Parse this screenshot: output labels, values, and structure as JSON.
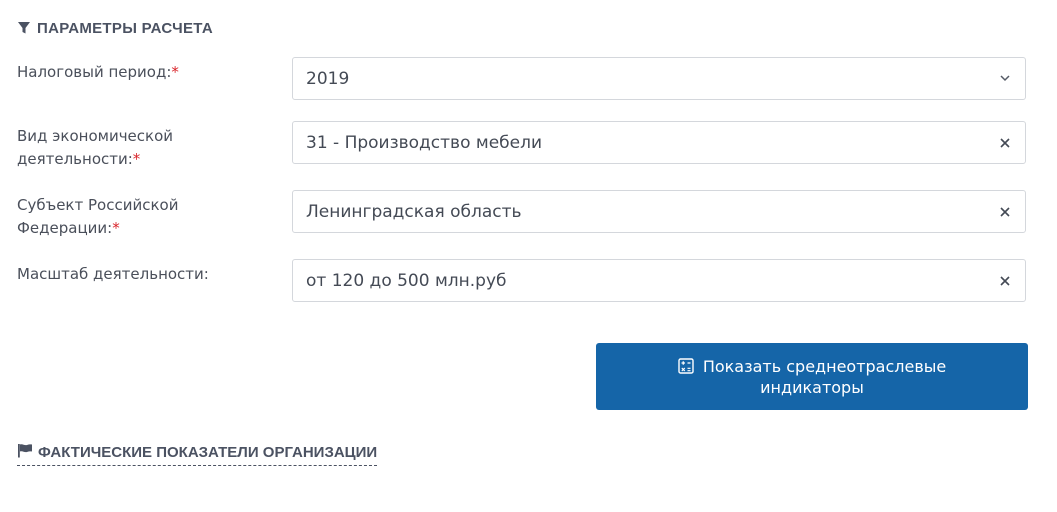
{
  "section": {
    "title": "ПАРАМЕТРЫ РАСЧЕТА",
    "icon": "filter-icon"
  },
  "form": {
    "required_mark": "*",
    "fields": [
      {
        "label": "Налоговый период:",
        "value": "2019",
        "control": "select",
        "icon": "chevron-down-icon"
      },
      {
        "label_line1": "Вид экономической",
        "label_line2": "деятельности:",
        "value": "31 - Производство мебели",
        "control": "clearable-select",
        "icon": "clear-icon"
      },
      {
        "label_line1": "Субъект Российской",
        "label_line2": "Федерации:",
        "value": "Ленинградская область",
        "control": "clearable-select",
        "icon": "clear-icon"
      },
      {
        "label": "Масштаб деятельности:",
        "value": "от 120 до 500 млн.руб",
        "control": "clearable-select",
        "icon": "clear-icon"
      }
    ]
  },
  "action": {
    "label_line1": "Показать среднеотраслевые",
    "label_line2": "индикаторы",
    "icon": "calculator-icon",
    "color": "#1565a8"
  },
  "subsection": {
    "title": "ФАКТИЧЕСКИЕ ПОКАЗАТЕЛИ ОРГАНИЗАЦИИ",
    "icon": "flag-icon"
  }
}
